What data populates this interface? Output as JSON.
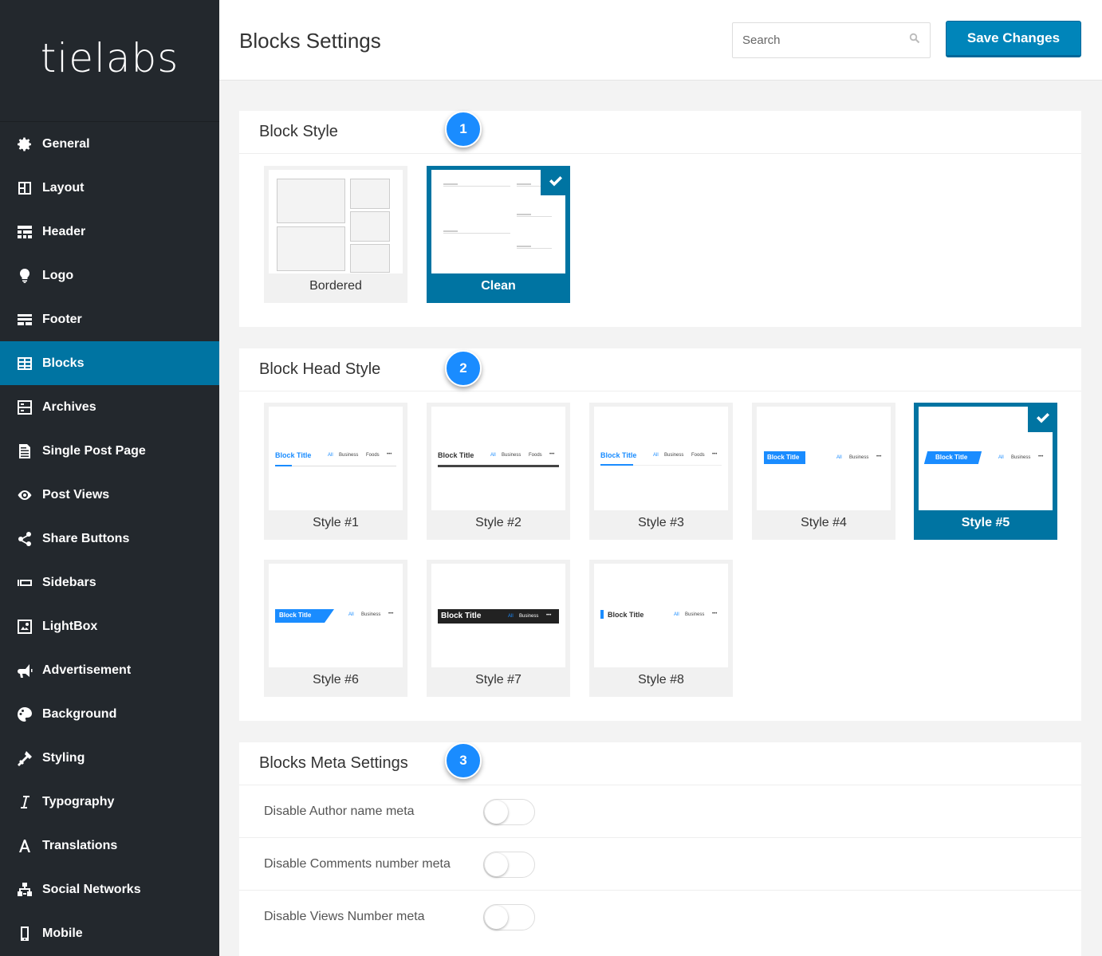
{
  "brand": {
    "logo": "tielabs"
  },
  "sidebar": {
    "items": [
      {
        "label": "General",
        "icon": "gear-icon"
      },
      {
        "label": "Layout",
        "icon": "layout-icon"
      },
      {
        "label": "Header",
        "icon": "header-icon"
      },
      {
        "label": "Logo",
        "icon": "lightbulb-icon"
      },
      {
        "label": "Footer",
        "icon": "footer-icon"
      },
      {
        "label": "Blocks",
        "icon": "blocks-icon",
        "active": true
      },
      {
        "label": "Archives",
        "icon": "archives-icon"
      },
      {
        "label": "Single Post Page",
        "icon": "document-icon"
      },
      {
        "label": "Post Views",
        "icon": "eye-icon"
      },
      {
        "label": "Share Buttons",
        "icon": "share-icon"
      },
      {
        "label": "Sidebars",
        "icon": "sidebars-icon"
      },
      {
        "label": "LightBox",
        "icon": "image-icon"
      },
      {
        "label": "Advertisement",
        "icon": "megaphone-icon"
      },
      {
        "label": "Background",
        "icon": "palette-icon"
      },
      {
        "label": "Styling",
        "icon": "brush-icon"
      },
      {
        "label": "Typography",
        "icon": "italic-icon"
      },
      {
        "label": "Translations",
        "icon": "letter-a-icon"
      },
      {
        "label": "Social Networks",
        "icon": "sitemap-icon"
      },
      {
        "label": "Mobile",
        "icon": "mobile-icon"
      }
    ]
  },
  "topbar": {
    "title": "Blocks Settings",
    "search_placeholder": "Search",
    "save_label": "Save Changes"
  },
  "colors": {
    "accent": "#0074a2",
    "badge": "#1a8cff",
    "sidebar_bg": "#23282d",
    "button": "#0085ba"
  },
  "block_style": {
    "title": "Block Style",
    "step": "1",
    "options": [
      {
        "label": "Bordered",
        "selected": false
      },
      {
        "label": "Clean",
        "selected": true
      }
    ]
  },
  "block_head_style": {
    "title": "Block Head Style",
    "step": "2",
    "options": [
      {
        "label": "Style #1",
        "selected": false
      },
      {
        "label": "Style #2",
        "selected": false
      },
      {
        "label": "Style #3",
        "selected": false
      },
      {
        "label": "Style #4",
        "selected": false
      },
      {
        "label": "Style #5",
        "selected": true
      },
      {
        "label": "Style #6",
        "selected": false
      },
      {
        "label": "Style #7",
        "selected": false
      },
      {
        "label": "Style #8",
        "selected": false
      }
    ],
    "preview": {
      "block_title": "Block Title",
      "tab_all": "All",
      "tab_business": "Business",
      "tab_foods": "Foods",
      "more": "•••"
    }
  },
  "meta_settings": {
    "title": "Blocks Meta Settings",
    "step": "3",
    "rows": [
      {
        "label": "Disable Author name meta",
        "enabled": false
      },
      {
        "label": "Disable Comments number meta",
        "enabled": false
      },
      {
        "label": "Disable Views Number meta",
        "enabled": false
      }
    ]
  }
}
